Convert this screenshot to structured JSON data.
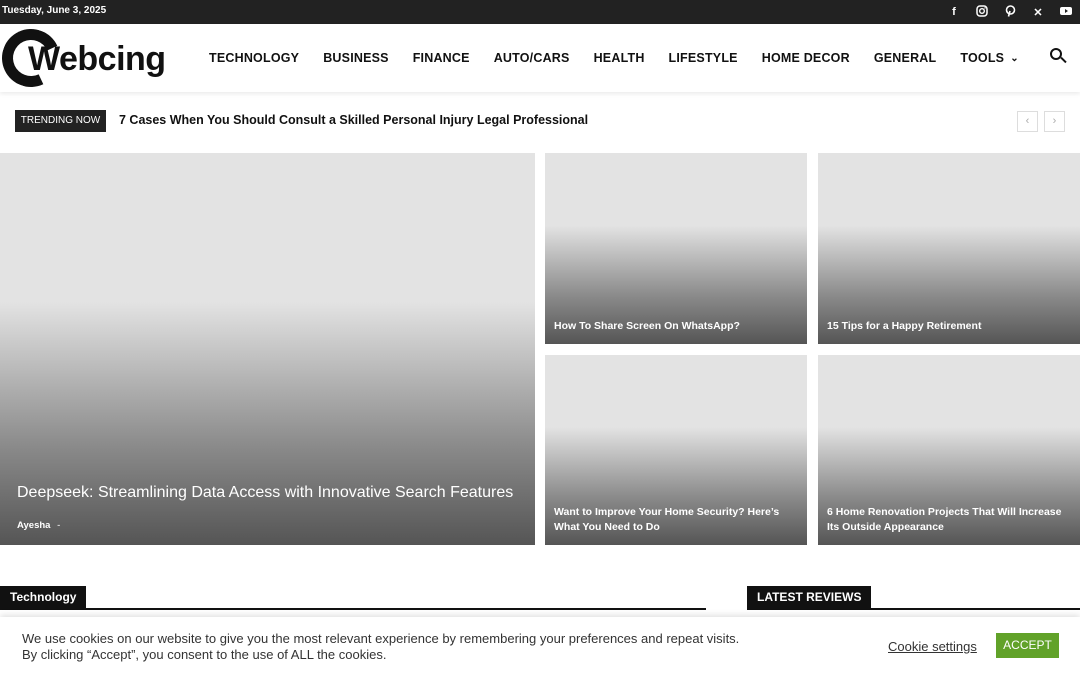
{
  "topbar": {
    "date": "Tuesday, June 3, 2025",
    "social_icons": [
      "facebook-icon",
      "instagram-icon",
      "pinterest-icon",
      "x-icon",
      "youtube-icon"
    ]
  },
  "logo": {
    "text": "Webcing"
  },
  "nav": {
    "items": [
      "TECHNOLOGY",
      "BUSINESS",
      "FINANCE",
      "AUTO/CARS",
      "HEALTH",
      "LIFESTYLE",
      "HOME DECOR",
      "GENERAL"
    ],
    "tools_label": "TOOLS",
    "tools_chevron": "⌄"
  },
  "trending": {
    "badge": "TRENDING NOW",
    "title": "7 Cases When You Should Consult a Skilled Personal Injury Legal Professional",
    "prev": "‹",
    "next": "›"
  },
  "featured": {
    "main": {
      "title": "Deepseek: Streamlining Data Access with Innovative Search Features",
      "author": "Ayesha",
      "separator": "-"
    },
    "tiles": [
      {
        "title": "How To Share Screen On WhatsApp?"
      },
      {
        "title": "15 Tips for a Happy Retirement"
      },
      {
        "title": "Want to Improve Your Home Security? Here’s What You Need to Do"
      },
      {
        "title": "6 Home Renovation Projects That Will Increase Its Outside Appearance"
      }
    ]
  },
  "sections": {
    "left": "Technology",
    "right": "LATEST REVIEWS"
  },
  "cookie": {
    "text": "We use cookies on our website to give you the most relevant experience by remembering your preferences and repeat visits. By clicking “Accept”, you consent to the use of ALL the cookies.",
    "settings": "Cookie settings",
    "accept": "ACCEPT"
  },
  "colors": {
    "dark": "#222222",
    "accept_green": "#61a229"
  }
}
